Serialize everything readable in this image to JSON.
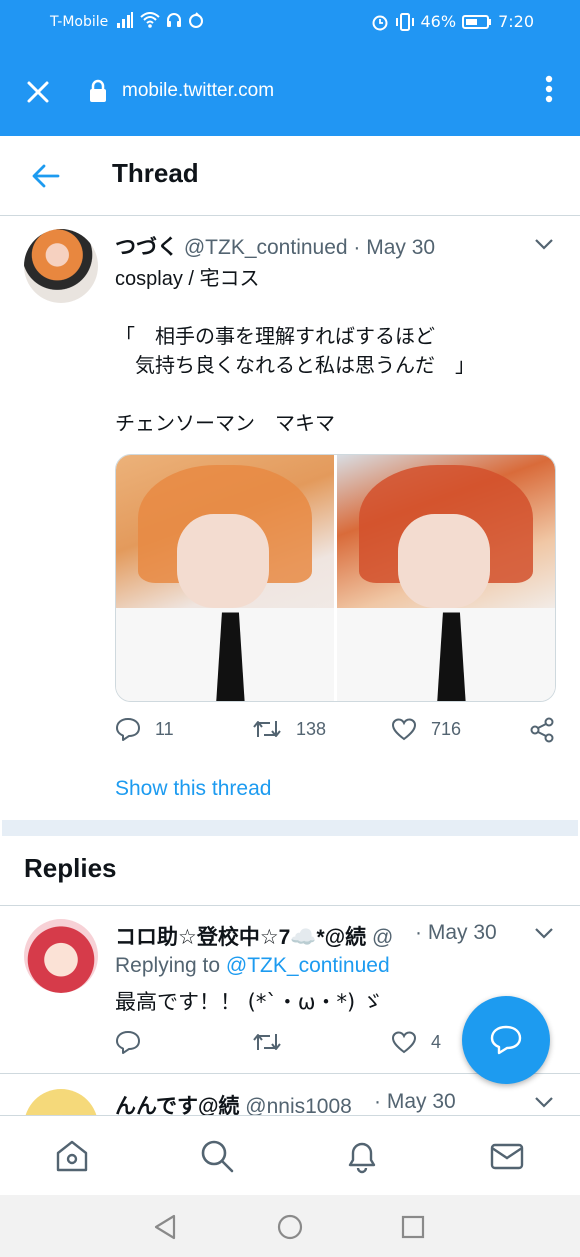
{
  "status_bar": {
    "carrier": "T-Mobile",
    "battery": "46%",
    "time": "7:20"
  },
  "browser": {
    "url": "mobile.twitter.com"
  },
  "header": {
    "title": "Thread"
  },
  "tweet": {
    "author_name": "つづく",
    "author_handle": "@TZK_continued",
    "date": "· May 30",
    "text_line1": "cosplay / 宅コス",
    "text_quote": "「　相手の事を理解すればするほど\n　気持ち良くなれると私は思うんだ　」",
    "text_tags": "チェンソーマン　マキマ",
    "replies": "11",
    "retweets": "138",
    "likes": "716",
    "show_thread": "Show this thread"
  },
  "replies_section": {
    "title": "Replies",
    "items": [
      {
        "author_name": "コロ助☆登校中☆7☁️*@続",
        "author_handle": "@",
        "date": "· May 30",
        "replying_prefix": "Replying to ",
        "replying_to": "@TZK_continued",
        "text": "最高です！！ (*ˋ・ω・*) ゞ",
        "likes": "4"
      },
      {
        "author_name": "んんです@続",
        "author_handle": "@nnis1008",
        "date": "· May 30"
      }
    ]
  },
  "colors": {
    "brand": "#2196f3",
    "twitter_blue": "#1d9bf0"
  }
}
